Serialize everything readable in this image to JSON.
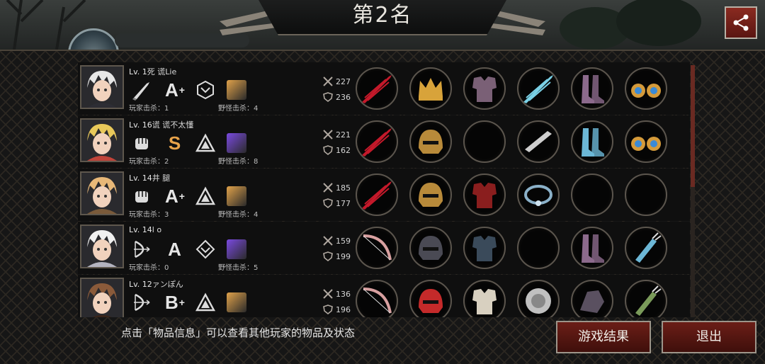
{
  "header": {
    "rank_title": "第2名"
  },
  "hint": "点击「物品信息」可以查看其他玩家的物品及状态",
  "buttons": {
    "result": "游戏结果",
    "exit": "退出"
  },
  "players": [
    {
      "level": "Lv. 1",
      "name": "死 谎Lie",
      "weapon_icon": "knife-icon",
      "grade": "A",
      "grade_plus": "+",
      "grade_color": "#e6e6e6",
      "symbol_icon": "hexagon-emblem-icon",
      "item_color": "#e0a24a",
      "player_kills": "玩家击杀：1",
      "monster_kills": "野怪击杀：4",
      "attack": "227",
      "defense": "236",
      "portrait_colors": [
        "#e6e6e6",
        "#2d2d34"
      ],
      "slots": [
        {
          "icon": "red-blade-icon",
          "color": "#c4192a"
        },
        {
          "icon": "golden-crown-icon",
          "color": "#d8a33a"
        },
        {
          "icon": "purple-armor-icon",
          "color": "#7a6076"
        },
        {
          "icon": "crystal-dagger-icon",
          "color": "#7ad1e6"
        },
        {
          "icon": "purple-boots-icon",
          "color": "#8c6a8c"
        },
        {
          "icon": "gold-earrings-icon",
          "color": "#d49a3a"
        }
      ]
    },
    {
      "level": "Lv. 16",
      "name": "谎 谎不太懂",
      "weapon_icon": "fist-icon",
      "grade": "S",
      "grade_plus": "",
      "grade_color": "#e8a34a",
      "symbol_icon": "triangle-emblem-icon",
      "item_color": "#7a4ae0",
      "player_kills": "玩家击杀：2",
      "monster_kills": "野怪击杀：8",
      "attack": "221",
      "defense": "162",
      "portrait_colors": [
        "#e8c85a",
        "#c0443a"
      ],
      "slots": [
        {
          "icon": "red-claw-icon",
          "color": "#c4192a"
        },
        {
          "icon": "gold-helmet-icon",
          "color": "#b88a3a"
        },
        {
          "icon": "empty-slot",
          "color": ""
        },
        {
          "icon": "silver-bracer-icon",
          "color": "#cfcfcf"
        },
        {
          "icon": "blue-boots-icon",
          "color": "#6cb7d6"
        },
        {
          "icon": "gold-earrings-icon",
          "color": "#d49a3a"
        }
      ]
    },
    {
      "level": "Lv. 14",
      "name": "井 腿",
      "weapon_icon": "fist-icon",
      "grade": "A",
      "grade_plus": "+",
      "grade_color": "#e6e6e6",
      "symbol_icon": "triangle-emblem-icon",
      "item_color": "#e0a24a",
      "player_kills": "玩家击杀：3",
      "monster_kills": "野怪击杀：4",
      "attack": "185",
      "defense": "177",
      "portrait_colors": [
        "#e8b878",
        "#7a5a3a"
      ],
      "slots": [
        {
          "icon": "red-claw-icon",
          "color": "#c4192a"
        },
        {
          "icon": "gold-helmet-icon",
          "color": "#b88a3a"
        },
        {
          "icon": "red-armor-icon",
          "color": "#8a1e1e"
        },
        {
          "icon": "pearl-necklace-icon",
          "color": "#8ab0c8"
        },
        {
          "icon": "empty-slot",
          "color": ""
        },
        {
          "icon": "empty-slot",
          "color": ""
        }
      ]
    },
    {
      "level": "Lv. 14",
      "name": "l o",
      "weapon_icon": "bow-icon",
      "grade": "A",
      "grade_plus": "",
      "grade_color": "#e6e6e6",
      "symbol_icon": "diamond-emblem-icon",
      "item_color": "#7a4ae0",
      "player_kills": "玩家击杀：0",
      "monster_kills": "野怪击杀：5",
      "attack": "159",
      "defense": "199",
      "portrait_colors": [
        "#f0f0f0",
        "#b4b4c0"
      ],
      "slots": [
        {
          "icon": "ornate-bow-icon",
          "color": "#d8a0a0"
        },
        {
          "icon": "dark-helmet-icon",
          "color": "#4a4a54"
        },
        {
          "icon": "dark-armor-icon",
          "color": "#3a4a5a"
        },
        {
          "icon": "empty-slot",
          "color": ""
        },
        {
          "icon": "purple-boots-icon",
          "color": "#8c6a8c"
        },
        {
          "icon": "arrow-quiver-icon",
          "color": "#6cb7d6"
        }
      ]
    },
    {
      "level": "Lv. 12",
      "name": "ァンぽん",
      "weapon_icon": "bow-icon",
      "grade": "B",
      "grade_plus": "+",
      "grade_color": "#e6e6e6",
      "symbol_icon": "triangle-emblem-icon",
      "item_color": "#e0a24a",
      "player_kills": "",
      "monster_kills": "",
      "attack": "136",
      "defense": "196",
      "portrait_colors": [
        "#8a5a3a",
        "#3a2418"
      ],
      "slots": [
        {
          "icon": "ornate-bow-icon",
          "color": "#d8a0a0"
        },
        {
          "icon": "red-helmet-icon",
          "color": "#c42a2a"
        },
        {
          "icon": "white-armor-icon",
          "color": "#d8d0c0"
        },
        {
          "icon": "silver-disc-icon",
          "color": "#c0c0c0"
        },
        {
          "icon": "dark-gauntlet-icon",
          "color": "#5a5060"
        },
        {
          "icon": "green-quiver-icon",
          "color": "#7a9a5a"
        }
      ]
    }
  ]
}
